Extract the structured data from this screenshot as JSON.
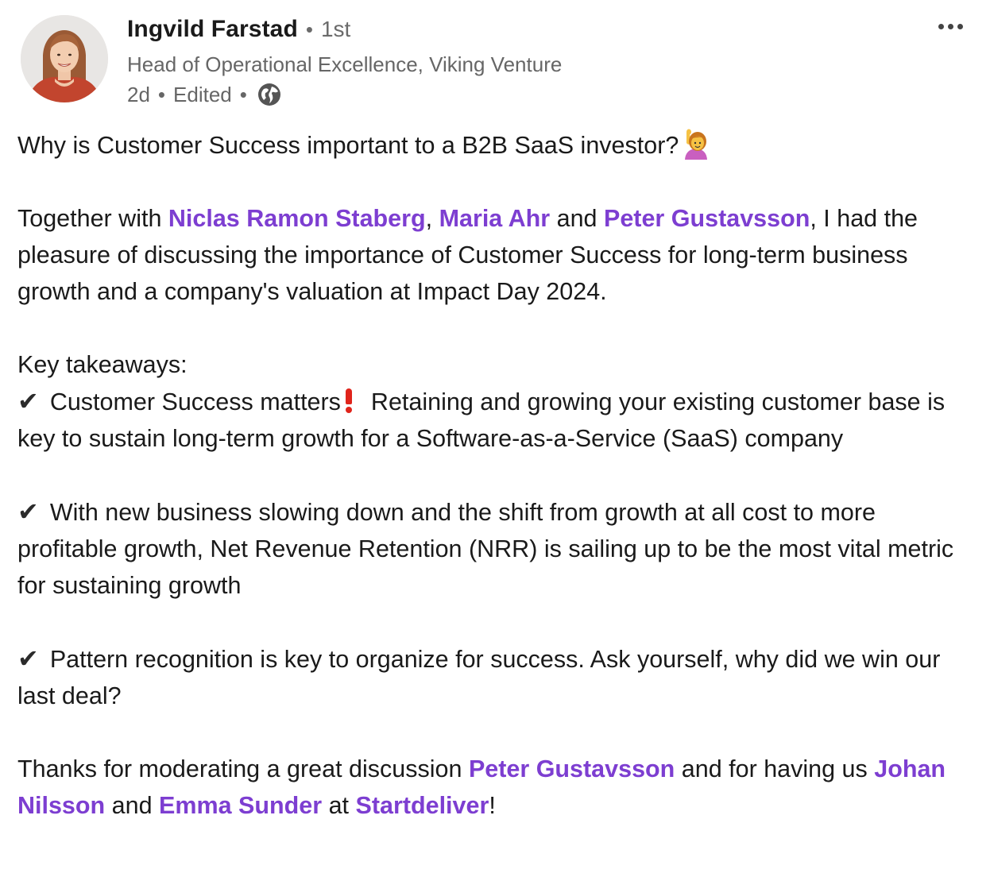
{
  "author": {
    "name": "Ingvild Farstad",
    "degree": "1st",
    "headline": "Head of Operational Excellence, Viking Venture",
    "time": "2d",
    "edited": "Edited",
    "visibility_icon": "globe-icon",
    "avatar_icon": "profile-photo"
  },
  "menu": {
    "more_icon": "more-options-icon"
  },
  "post": {
    "q": "Why is Customer Success important to a B2B SaaS investor?",
    "p1_a": "Together with ",
    "p1_m1": "Niclas Ramon Staberg",
    "p1_b": ", ",
    "p1_m2": "Maria Ahr",
    "p1_c": " and ",
    "p1_m3": "Peter Gustavsson",
    "p1_d": ", I had the pleasure of discussing the importance of Customer Success for long-term business growth and a company's valuation at Impact Day 2024.",
    "takeaways_heading": "Key takeaways:",
    "t1_a": "Customer Success matters",
    "t1_b": "Retaining and growing your existing customer base is key to sustain long-term growth for a Software-as-a-Service (SaaS) company",
    "t2": "With new business slowing down and the shift from growth at all cost to more profitable growth, Net Revenue Retention (NRR) is sailing up to be the most vital metric for sustaining growth",
    "t3": "Pattern recognition is key to organize for success. Ask yourself, why did we win our last deal?",
    "thanks_a": "Thanks for moderating a great discussion ",
    "thanks_m1": "Peter Gustavsson",
    "thanks_b": " and for having us ",
    "thanks_m2": "Johan Nilsson",
    "thanks_c": " and ",
    "thanks_m3": "Emma Sunder",
    "thanks_d": " at ",
    "thanks_m4": "Startdeliver",
    "thanks_e": "!",
    "check_glyph": "✔",
    "check_icon": "check-mark-icon",
    "exclamation_icon": "red-exclamation-icon",
    "raising_hand_icon": "person-raising-hand-icon"
  },
  "colors": {
    "mention": "#7d3ed1",
    "text": "#1a1a1a",
    "muted": "#666666",
    "exclamation": "#e0241b"
  }
}
